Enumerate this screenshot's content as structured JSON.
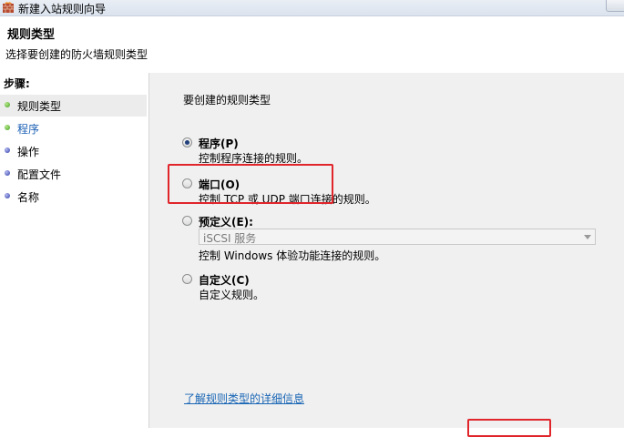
{
  "window": {
    "title": "新建入站规则向导"
  },
  "header": {
    "title": "规则类型",
    "subtitle": "选择要创建的防火墙规则类型"
  },
  "steps": {
    "label": "步骤:",
    "items": [
      {
        "label": "规则类型",
        "state": "done"
      },
      {
        "label": "程序",
        "state": "current"
      },
      {
        "label": "操作",
        "state": "todo"
      },
      {
        "label": "配置文件",
        "state": "todo"
      },
      {
        "label": "名称",
        "state": "todo"
      }
    ]
  },
  "main": {
    "question": "要创建的规则类型",
    "options": [
      {
        "label": "程序(P)",
        "desc": "控制程序连接的规则。",
        "checked": true
      },
      {
        "label": "端口(O)",
        "desc": "控制 TCP 或 UDP 端口连接的规则。",
        "checked": false
      },
      {
        "label": "预定义(E):",
        "dropdown": "iSCSI 服务",
        "desc": "控制 Windows 体验功能连接的规则。",
        "checked": false
      },
      {
        "label": "自定义(C)",
        "desc": "自定义规则。",
        "checked": false
      }
    ],
    "learn_link": "了解规则类型的详细信息"
  },
  "colors": {
    "highlight": "#e0252b",
    "link": "#1a66b5",
    "panel": "#f0f0f0"
  }
}
